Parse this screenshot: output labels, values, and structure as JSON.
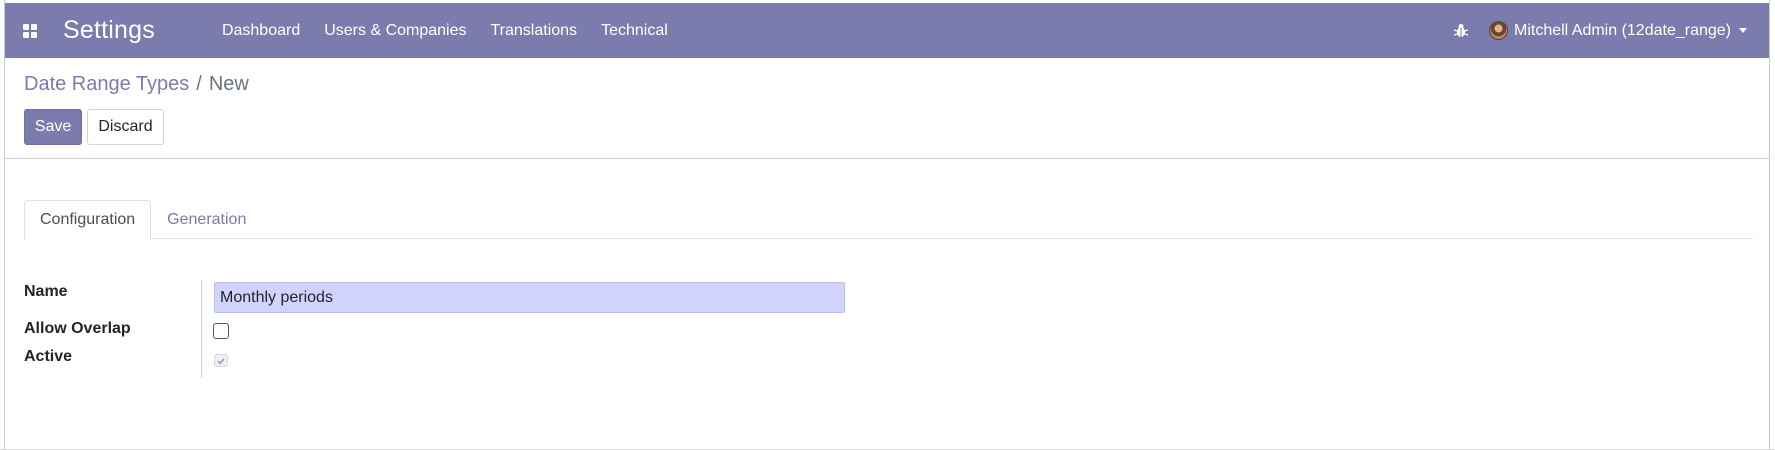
{
  "navbar": {
    "app_title": "Settings",
    "menu": [
      {
        "label": "Dashboard"
      },
      {
        "label": "Users & Companies"
      },
      {
        "label": "Translations"
      },
      {
        "label": "Technical"
      }
    ],
    "user": "Mitchell Admin (12date_range)",
    "icons": [
      "apps-grid-icon",
      "bug-icon",
      "avatar",
      "caret-down-icon"
    ],
    "color": "#7c7bad"
  },
  "breadcrumb": {
    "parent": "Date Range Types",
    "separator": "/",
    "current": "New"
  },
  "buttons": {
    "save": "Save",
    "discard": "Discard"
  },
  "tabs": [
    {
      "label": "Configuration",
      "active": true
    },
    {
      "label": "Generation",
      "active": false
    }
  ],
  "form": {
    "name_label": "Name",
    "name_value": "Monthly periods",
    "allow_overlap_label": "Allow Overlap",
    "allow_overlap_checked": false,
    "active_label": "Active",
    "active_checked": true
  }
}
